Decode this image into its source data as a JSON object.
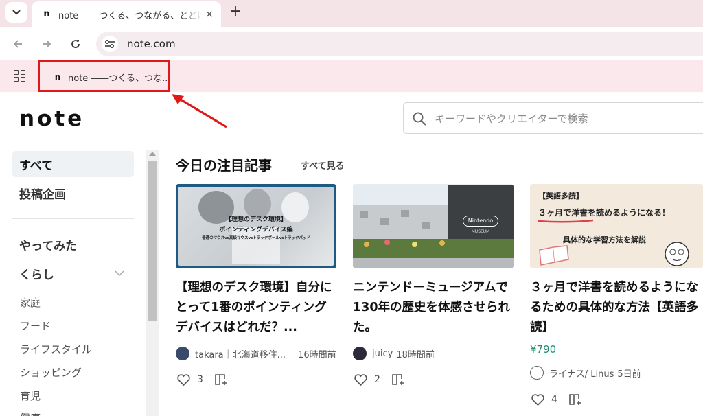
{
  "browser": {
    "tab_title": "note ――つくる、つながる、とどける。",
    "tab_close": "×",
    "new_tab": "+",
    "url": "note.com",
    "bookmark_label": "note ――つくる、つな..."
  },
  "header": {
    "logo": "note",
    "search_placeholder": "キーワードやクリエイターで検索"
  },
  "sidebar": {
    "items": [
      {
        "label": "すべて",
        "active": true
      },
      {
        "label": "投稿企画"
      },
      {
        "label": "やってみた"
      },
      {
        "label": "くらし"
      }
    ],
    "sub_items": [
      "家庭",
      "フード",
      "ライフスタイル",
      "ショッピング",
      "育児",
      "健康"
    ]
  },
  "main": {
    "section_title": "今日の注目記事",
    "see_all": "すべて見る",
    "cards": [
      {
        "thumb_lines": [
          "【理想のデスク環境】",
          "ポインティングデバイス編",
          "普通のマウスvs高級マウスvsトラックボールvsトラックパッド"
        ],
        "title": "【理想のデスク環境】自分にとって1番のポインティングデバイスはどれだ？...",
        "author": "takara｜北海道移住...",
        "time": "16時間前",
        "likes": "3"
      },
      {
        "thumb_lines": [
          "Nintendo",
          "MUSEUM"
        ],
        "title": "ニンテンドーミュージアムで130年の歴史を体感させられた。",
        "author": "juicy",
        "time": "18時間前",
        "likes": "2"
      },
      {
        "thumb_lines": [
          "【英語多読】",
          "３ヶ月で洋書を読めるようになる！",
          "具体的な学習方法を解説"
        ],
        "title": "３ヶ月で洋書を読めるようになるための具体的な方法【英語多読】",
        "price": "¥790",
        "author": "ライナス/ Linus",
        "time": "5日前",
        "likes": "4"
      }
    ]
  },
  "colors": {
    "tabstrip": "#f5e4e7",
    "bookmark_bar": "#fbe8ec",
    "highlight": "#e01818",
    "price": "#1b8f6f"
  }
}
